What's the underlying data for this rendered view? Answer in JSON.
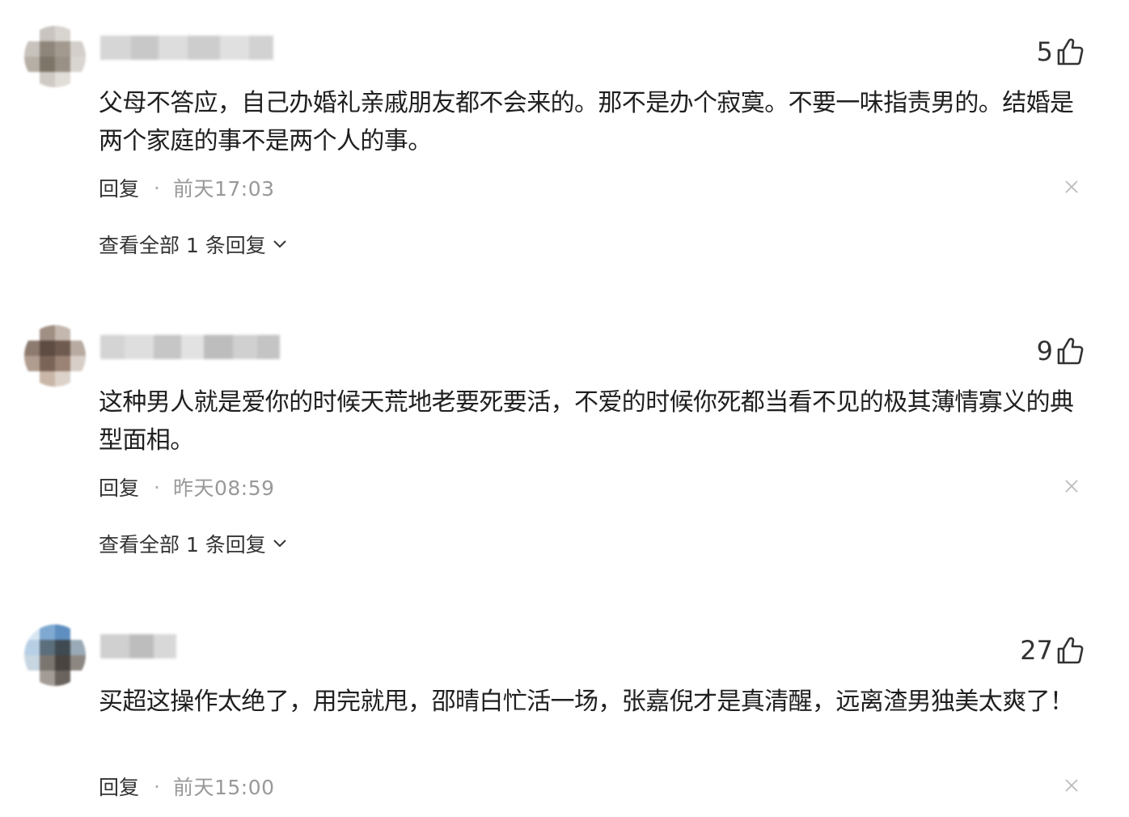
{
  "comments": [
    {
      "likes": "5",
      "text": "父母不答应，自己办婚礼亲戚朋友都不会来的。那不是办个寂寞。不要一味指责男的。结婚是两个家庭的事不是两个人的事。",
      "reply_label": "回复",
      "separator": "·",
      "time": "前天17:03",
      "view_all_label": "查看全部 1 条回复",
      "avatar_icon": "blurred-avatar",
      "like_icon": "thumbs-up-icon",
      "close_icon": "close-icon"
    },
    {
      "likes": "9",
      "text": "这种男人就是爱你的时候天荒地老要死要活，不爱的时候你死都当看不见的极其薄情寡义的典型面相。",
      "reply_label": "回复",
      "separator": "·",
      "time": "昨天08:59",
      "view_all_label": "查看全部 1 条回复",
      "avatar_icon": "blurred-avatar",
      "like_icon": "thumbs-up-icon",
      "close_icon": "close-icon"
    },
    {
      "likes": "27",
      "text": "买超这操作太绝了，用完就甩，邵晴白忙活一场，张嘉倪才是真清醒，远离渣男独美太爽了！",
      "reply_label": "回复",
      "separator": "·",
      "time": "前天15:00",
      "avatar_icon": "blurred-avatar",
      "like_icon": "thumbs-up-icon",
      "close_icon": "close-icon"
    }
  ],
  "colors": {
    "text": "#1f1f1f",
    "meta_time": "#999999",
    "icon_gray": "#bbbbbb"
  }
}
